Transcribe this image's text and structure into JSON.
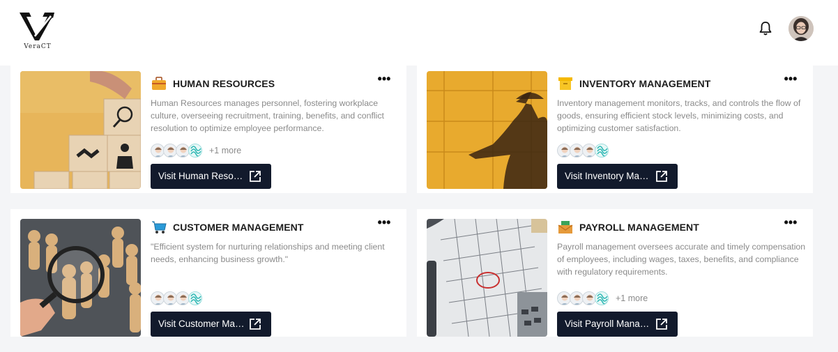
{
  "header": {
    "logo_text": "VeraCT",
    "notification_icon": "bell-icon",
    "avatar_icon": "user-avatar"
  },
  "cards": [
    {
      "title": "HUMAN RESOURCES",
      "icon": "briefcase-icon",
      "icon_color": "#f0a92c",
      "description": "Human Resources manages personnel, fostering workplace culture, overseeing recruitment, training, benefits, and conflict resolution to optimize employee performance.",
      "extra_members": "+1 more",
      "visit_label": "Visit Human Resources"
    },
    {
      "title": "INVENTORY MANAGEMENT",
      "icon": "box-icon",
      "icon_color": "#f5b800",
      "description": "Inventory management monitors, tracks, and controls the flow of goods, ensuring efficient stock levels, minimizing costs, and optimizing customer satisfaction.",
      "extra_members": "",
      "visit_label": "Visit Inventory Management"
    },
    {
      "title": "CUSTOMER MANAGEMENT",
      "icon": "shopping-cart-icon",
      "icon_color": "#2a9ad8",
      "description": "\"Efficient system for nurturing relationships and meeting client needs, enhancing business growth.\"",
      "extra_members": "",
      "visit_label": "Visit Customer Management"
    },
    {
      "title": "PAYROLL MANAGEMENT",
      "icon": "money-envelope-icon",
      "icon_color": "#3aa35a",
      "description": "Payroll management oversees accurate and timely compensation of employees, including wages, taxes, benefits, and compliance with regulatory requirements.",
      "extra_members": "+1 more",
      "visit_label": "Visit Payroll Management"
    }
  ]
}
